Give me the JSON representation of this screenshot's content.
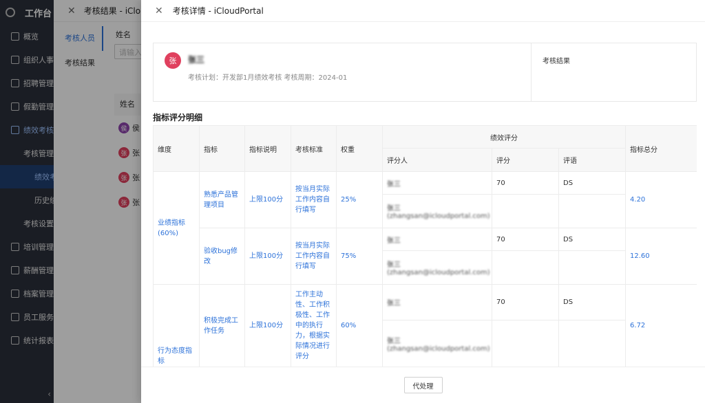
{
  "app": {
    "title": "工作台",
    "nav": [
      {
        "label": "概览",
        "level": 0
      },
      {
        "label": "组织人事",
        "level": 0
      },
      {
        "label": "招聘管理",
        "level": 0
      },
      {
        "label": "假勤管理",
        "level": 0
      },
      {
        "label": "绩效考核",
        "level": 0,
        "active": true
      },
      {
        "label": "考核管理",
        "level": 1,
        "active": true
      },
      {
        "label": "绩效考",
        "level": 2,
        "active": true
      },
      {
        "label": "历史绩",
        "level": 2
      },
      {
        "label": "考核设置",
        "level": 1
      },
      {
        "label": "培训管理",
        "level": 0
      },
      {
        "label": "薪酬管理",
        "level": 0
      },
      {
        "label": "档案管理",
        "level": 0
      },
      {
        "label": "员工服务",
        "level": 0
      },
      {
        "label": "统计报表",
        "level": 0
      }
    ],
    "collapse_icon": "‹"
  },
  "drawer1": {
    "close_icon": "✕",
    "title": "考核结果 - iCloudPortal",
    "tabs": [
      "考核人员",
      "考核结果"
    ],
    "filter_label": "姓名",
    "filter_placeholder": "请输入",
    "table_header": "姓名",
    "rows": [
      {
        "avatar": "侯",
        "name": "侯",
        "color": "#8e44ad"
      },
      {
        "avatar": "张",
        "name": "张",
        "color": "#e0405e"
      },
      {
        "avatar": "张",
        "name": "张",
        "color": "#e0405e"
      },
      {
        "avatar": "张",
        "name": "张",
        "color": "#e0405e"
      }
    ]
  },
  "drawer2": {
    "close_icon": "✕",
    "title": "考核详情 - iCloudPortal",
    "employee": {
      "avatar": "张",
      "name": "张三",
      "meta": "考核计划：开发部1月绩效考核  考核周期：2024-01"
    },
    "result_label": "考核结果",
    "section_title": "指标评分明细",
    "table": {
      "headers": {
        "dimension": "维度",
        "indicator": "指标",
        "description": "指标说明",
        "standard": "考核标准",
        "weight": "权重",
        "performance": "绩效评分",
        "rater": "评分人",
        "score": "评分",
        "comment": "评语",
        "total": "指标总分"
      },
      "groups": [
        {
          "dimension": "业绩指标(60%)",
          "items": [
            {
              "indicator": "熟悉产品管理项目",
              "description": "上限100分",
              "standard": "按当月实际工作内容自行填写",
              "weight": "25%",
              "total": "4.20",
              "raters": [
                {
                  "name": "张三",
                  "email": "",
                  "score": "70",
                  "comment": "DS"
                },
                {
                  "name": "张三",
                  "email": "(zhangsan@icloudportal.com)",
                  "score": "",
                  "comment": ""
                }
              ]
            },
            {
              "indicator": "验收bug修改",
              "description": "上限100分",
              "standard": "按当月实际工作内容自行填写",
              "weight": "75%",
              "total": "12.60",
              "raters": [
                {
                  "name": "张三",
                  "email": "",
                  "score": "70",
                  "comment": "DS"
                },
                {
                  "name": "张三",
                  "email": "(zhangsan@icloudportal.com)",
                  "score": "",
                  "comment": ""
                }
              ]
            }
          ]
        },
        {
          "dimension": "行为态度指标",
          "items": [
            {
              "indicator": "积极完成工作任务",
              "description": "上限100分",
              "standard": "工作主动性、工作积极性、工作中的执行力，根据实际情况进行评分",
              "weight": "60%",
              "total": "6.72",
              "raters": [
                {
                  "name": "张三",
                  "email": "",
                  "score": "70",
                  "comment": "DS"
                },
                {
                  "name": "张三",
                  "email": "(zhangsan@icloudportal.com)",
                  "score": "",
                  "comment": ""
                }
              ]
            }
          ]
        }
      ]
    },
    "footer_button": "代处理"
  }
}
